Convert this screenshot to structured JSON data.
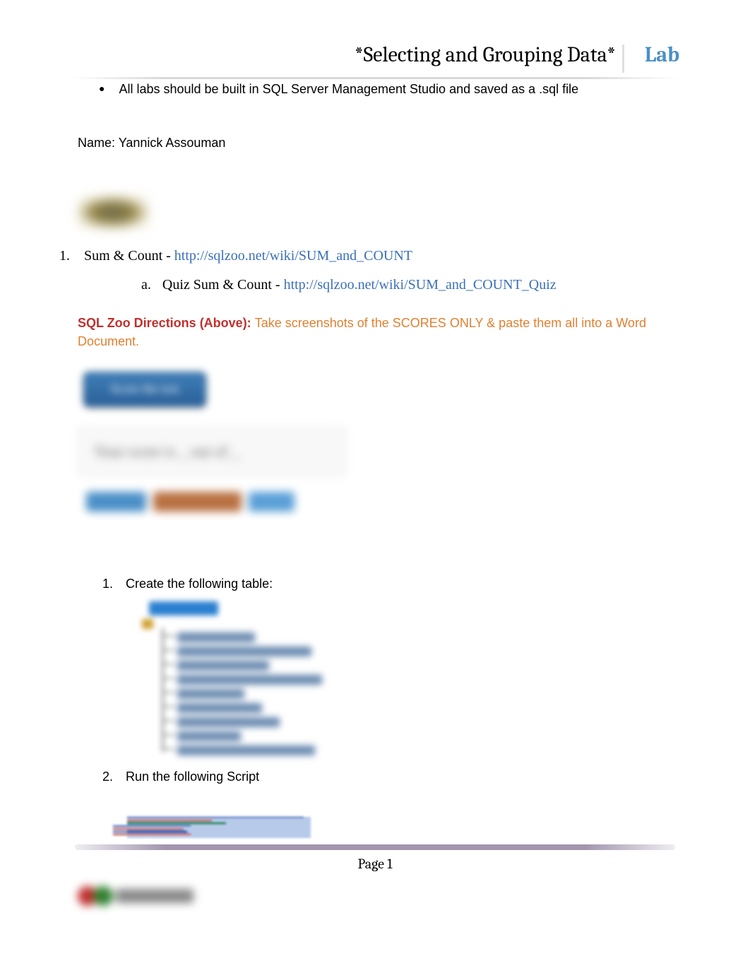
{
  "header": {
    "title_main": "*Selecting and Grouping Data*",
    "title_lab": "Lab"
  },
  "bullet": {
    "text": "All labs should be built in SQL Server Management Studio and saved as a .sql file"
  },
  "name_line": "Name: Yannick Assouman",
  "item1": {
    "number": "1.",
    "prefix": "Sum & Count - ",
    "link": "http://sqlzoo.net/wiki/SUM_and_COUNT"
  },
  "item1a": {
    "letter": "a.",
    "prefix": "Quiz Sum & Count -  ",
    "link": "http://sqlzoo.net/wiki/SUM_and_COUNT_Quiz"
  },
  "directions": {
    "label": "SQL Zoo Directions (Above): ",
    "text": "Take screenshots of the SCORES ONLY & paste them all into a Word Document."
  },
  "sub1": {
    "number": "1.",
    "text": "Create the following table:"
  },
  "sub2": {
    "number": "2.",
    "text": "Run the following Script"
  },
  "page": "Page 1"
}
